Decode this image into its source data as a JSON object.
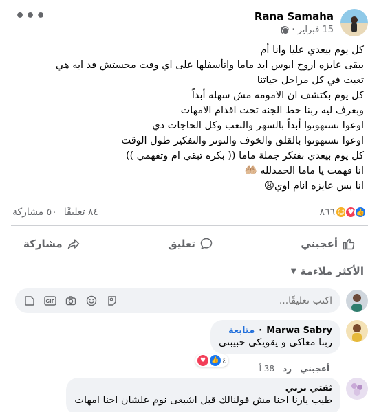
{
  "post": {
    "author": "Rana Samaha",
    "date": "15 فبراير ·",
    "privacy_icon": "globe-icon",
    "more_label": "•••",
    "lines": [
      "كل يوم بيعدي عليا وانا أم",
      "ببقى عايزه اروح ابوس ايد ماما واتأسفلها على اي وقت محستش قد ايه هي",
      "تعبت في كل مراحل حياتنا",
      "كل يوم بكتشف ان الامومه مش سهله أبداً",
      "وبعرف ليه ربنا حط الجنه تحت اقدام الامهات",
      "اوعوا تستهونوا أبداً بالسهر والتعب وكل الحاجات دي",
      "اوعوا تستهونوا بالقلق والخوف والتوتر والتفكير طول الوقت",
      "كل يوم بيعدي بفتكر جملة ماما (( بكره تبقي ام وتفهمي ))",
      "انا فهمت يا ماما الحمدلله 🤲🏼",
      "انا بس عايزه انام اوي😩"
    ]
  },
  "stats": {
    "reactions_count": "٨٦٦",
    "comments": "٨٤ تعليقًا",
    "shares": "٥٠ مشاركة"
  },
  "actions": {
    "like": "أعجبني",
    "comment": "تعليق",
    "share": "مشاركة"
  },
  "comments_section": {
    "sort_label": "الأكثر ملاءمة",
    "composer_placeholder": "اكتب تعليقًا..."
  },
  "comments": [
    {
      "author": "Marwa Sabry",
      "follow": "متابعة",
      "text": "ربنا معاكى و يقويكى حبيبتى",
      "like": "أعجبني",
      "reply": "رد",
      "time": "38 أ",
      "reactions": "٤"
    },
    {
      "author": "ثقتي بربي",
      "text": "طيب يارنا احنا مش قولنالك قبل اشبعى نوم علشان احنا امهات"
    }
  ],
  "colors": {
    "accent": "#1877f2",
    "love": "#f33e58",
    "haha": "#f7b125",
    "follow": "#216fdb",
    "muted": "#65676b"
  }
}
